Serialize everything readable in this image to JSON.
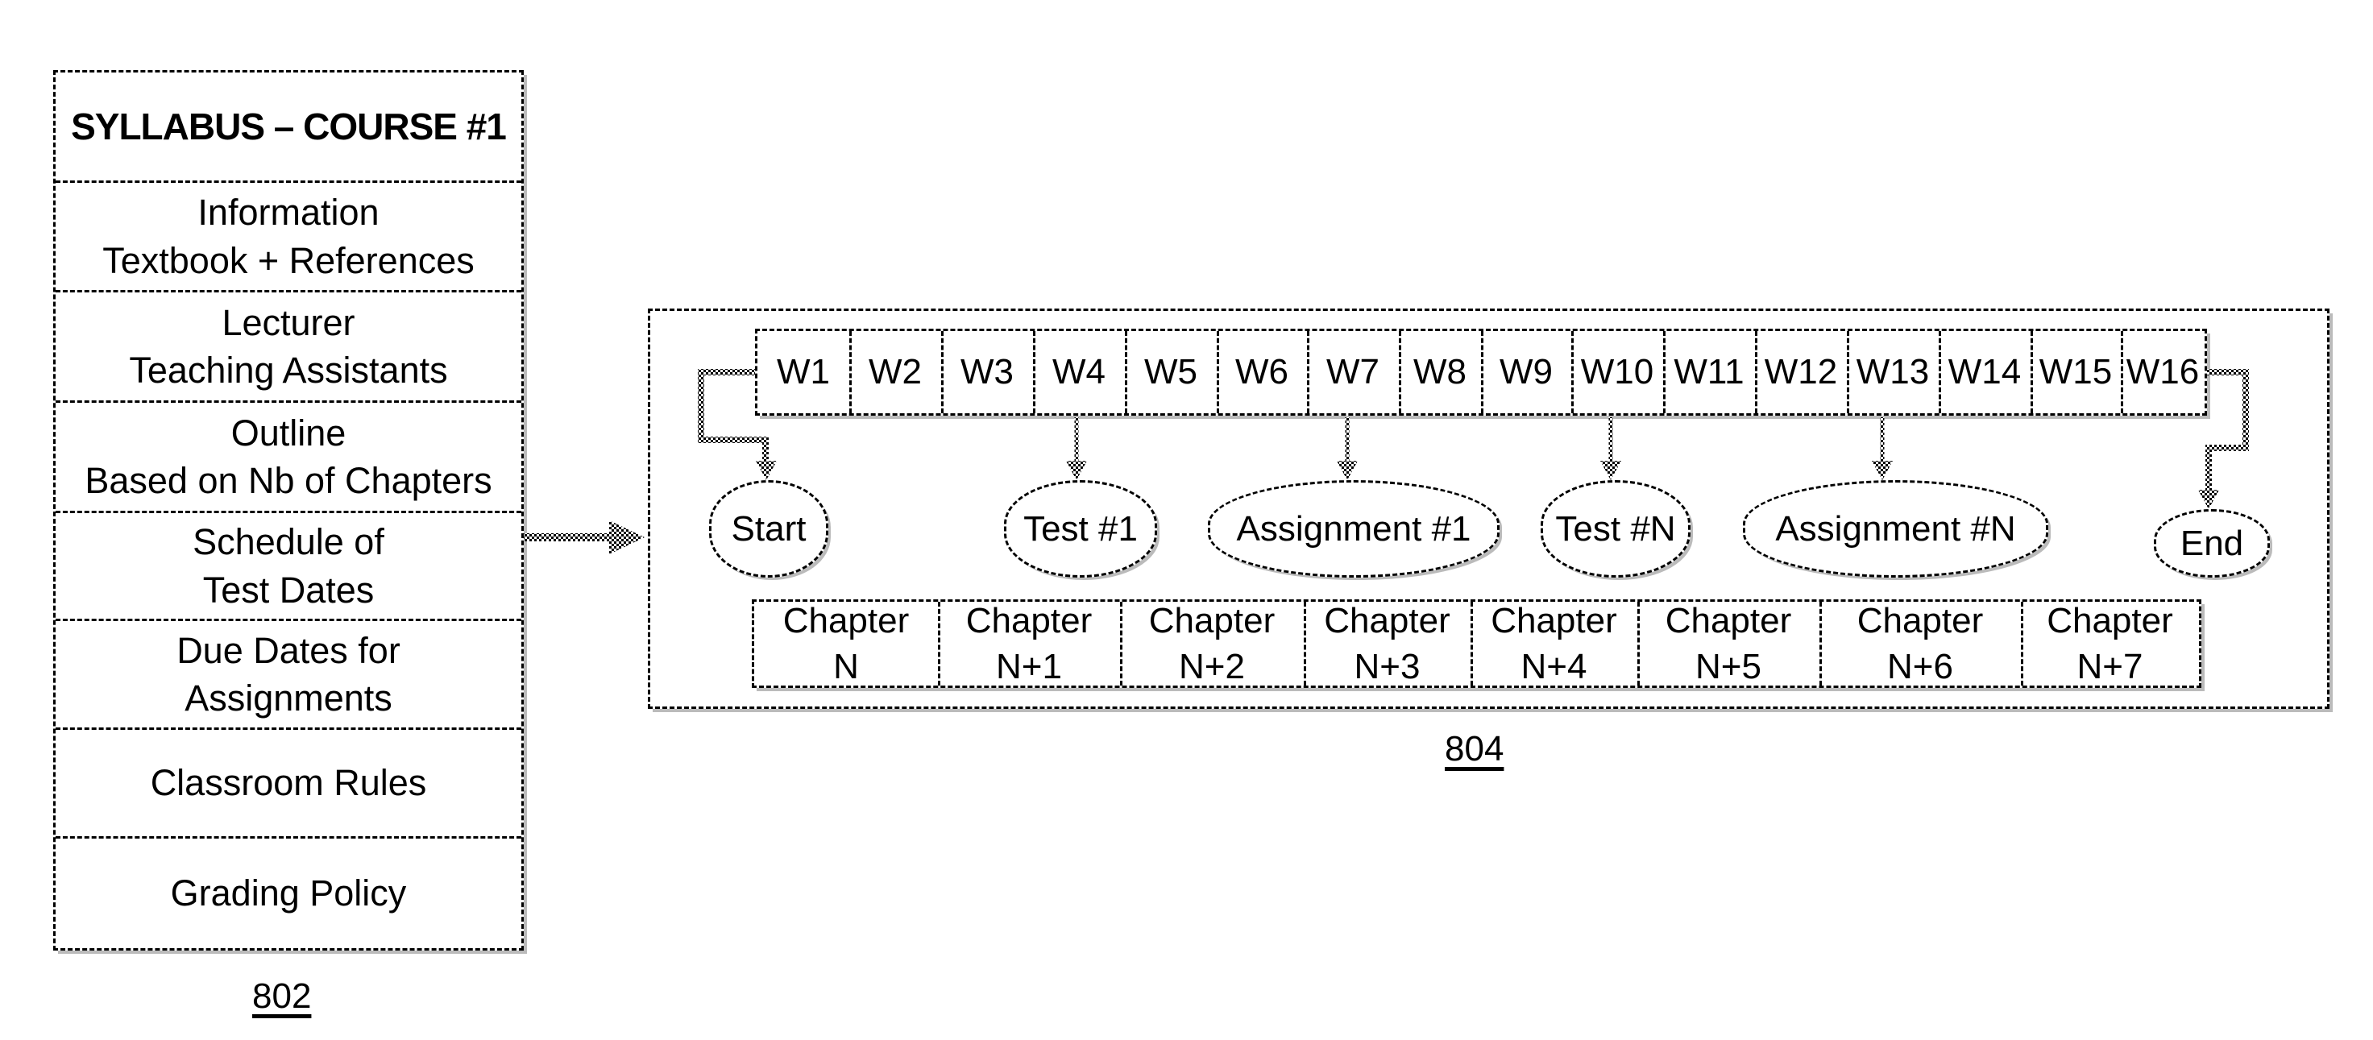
{
  "syllabus": {
    "ref_label": "802",
    "rows": [
      {
        "id": "title",
        "text": "SYLLABUS – COURSE #1"
      },
      {
        "id": "information",
        "text": "Information\nTextbook + References"
      },
      {
        "id": "lecturer",
        "text": "Lecturer\nTeaching Assistants"
      },
      {
        "id": "outline",
        "text": "Outline\nBased on Nb of Chapters"
      },
      {
        "id": "test-schedule",
        "text": "Schedule of\nTest Dates"
      },
      {
        "id": "due-dates",
        "text": "Due Dates for\nAssignments"
      },
      {
        "id": "classroom-rules",
        "text": "Classroom Rules"
      },
      {
        "id": "grading-policy",
        "text": "Grading Policy"
      }
    ]
  },
  "schedule": {
    "ref_label": "804",
    "weeks": [
      "W1",
      "W2",
      "W3",
      "W4",
      "W5",
      "W6",
      "W7",
      "W8",
      "W9",
      "W10",
      "W11",
      "W12",
      "W13",
      "W14",
      "W15",
      "W16"
    ],
    "events": [
      {
        "id": "start",
        "label": "Start",
        "week": "W1"
      },
      {
        "id": "test-1",
        "label": "Test #1",
        "week": "W4"
      },
      {
        "id": "assignment-1",
        "label": "Assignment #1",
        "week": "W7"
      },
      {
        "id": "test-n",
        "label": "Test #N",
        "week": "W10"
      },
      {
        "id": "assignment-n",
        "label": "Assignment #N",
        "week": "W13"
      },
      {
        "id": "end",
        "label": "End",
        "week": "W16"
      }
    ],
    "chapters": [
      {
        "line1": "Chapter",
        "line2": "N"
      },
      {
        "line1": "Chapter",
        "line2": "N+1"
      },
      {
        "line1": "Chapter",
        "line2": "N+2"
      },
      {
        "line1": "Chapter",
        "line2": "N+3"
      },
      {
        "line1": "Chapter",
        "line2": "N+4"
      },
      {
        "line1": "Chapter",
        "line2": "N+5"
      },
      {
        "line1": "Chapter",
        "line2": "N+6"
      },
      {
        "line1": "Chapter",
        "line2": "N+7"
      }
    ]
  }
}
